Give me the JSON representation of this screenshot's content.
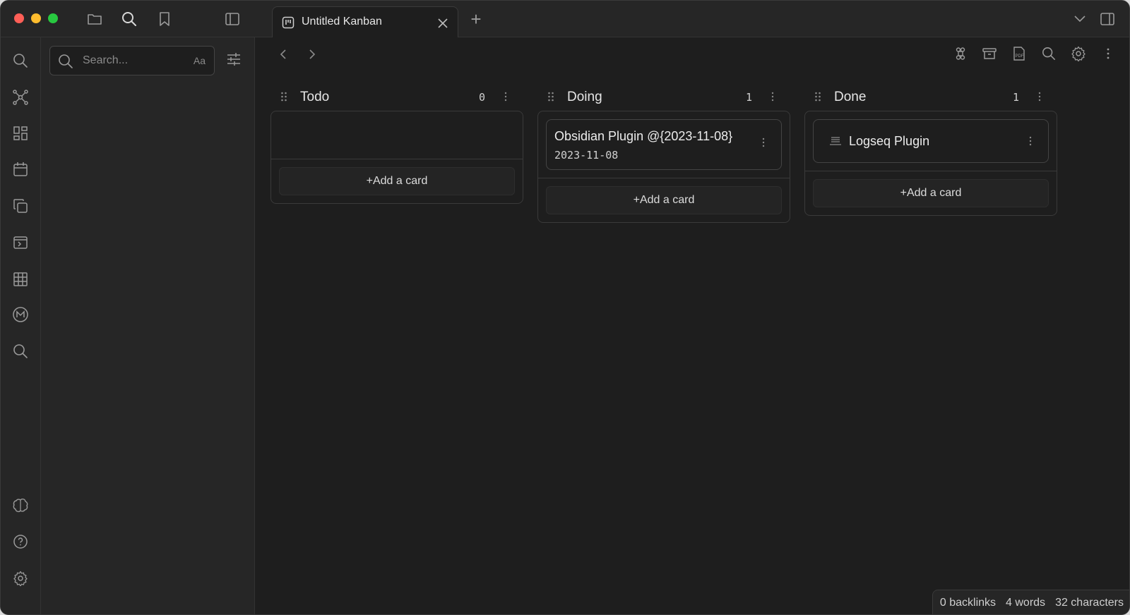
{
  "window": {
    "controls": [
      "close",
      "minimize",
      "maximize"
    ]
  },
  "toolbar": {
    "icons": [
      "folder-icon",
      "search-icon",
      "bookmark-icon",
      "sidebar-toggle-icon"
    ]
  },
  "tab": {
    "label": "Untitled Kanban",
    "new_tab_symbol": "+"
  },
  "sidebar": {
    "search_placeholder": "Search...",
    "match_case_label": "Aa"
  },
  "ribbon": {
    "items": [
      "search",
      "graph",
      "dashboard",
      "calendar",
      "copy",
      "terminal",
      "table",
      "excalidraw",
      "search-alt",
      "brain",
      "help",
      "settings"
    ]
  },
  "kanban": {
    "lanes": [
      {
        "title": "Todo",
        "count": "0",
        "cards": [],
        "add_label": "+Add a card"
      },
      {
        "title": "Doing",
        "count": "1",
        "cards": [
          {
            "title": "Obsidian Plugin @{2023-11-08}",
            "date": "2023-11-08"
          }
        ],
        "add_label": "+Add a card"
      },
      {
        "title": "Done",
        "count": "1",
        "cards": [
          {
            "title": "Logseq Plugin",
            "date": ""
          }
        ],
        "add_label": "+Add a card"
      }
    ]
  },
  "statusbar": {
    "backlinks": "0 backlinks",
    "words": "4 words",
    "characters": "32 characters"
  },
  "colors": {
    "background": "#1e1e1e",
    "panel": "#262626",
    "border": "#3a3a3a",
    "text": "#e6e6e6"
  }
}
